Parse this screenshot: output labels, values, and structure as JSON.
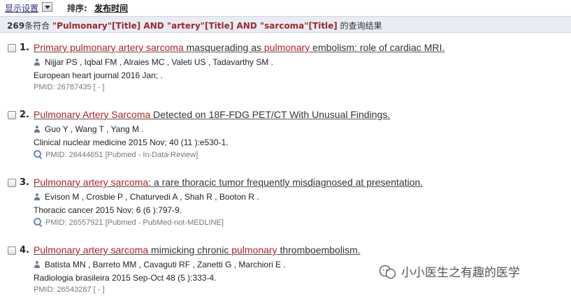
{
  "toolbar": {
    "display_settings": "显示设置",
    "sort_label": "排序:",
    "sort_value": "发布时间"
  },
  "summary": {
    "count": "269",
    "pre": "条符合 ",
    "query": "\"Pulmonary\"[Title] AND \"artery\"[Title] AND \"sarcoma\"[Title]",
    "post": " 的查询结果"
  },
  "results": [
    {
      "num": "1.",
      "title_parts": [
        {
          "t": "Primary pulmonary artery sarcoma",
          "hl": true
        },
        {
          "t": " masquerading as ",
          "hl": false
        },
        {
          "t": "pulmonary",
          "hl": true
        },
        {
          "t": " embolism: role of cardiac MRI.",
          "hl": false
        }
      ],
      "authors": "Nijjar PS , Iqbal FM , Alraies MC , Valeti US , Tadavarthy SM .",
      "journal": "European heart journal 2016 Jan; .",
      "pmid": "PMID: 26787435 [ - ]",
      "has_related_icon": false
    },
    {
      "num": "2.",
      "title_parts": [
        {
          "t": "Pulmonary Artery Sarcoma",
          "hl": true
        },
        {
          "t": " Detected on 18F-FDG PET/CT With Unusual Findings.",
          "hl": false
        }
      ],
      "authors": "Guo Y , Wang T , Yang M .",
      "journal": "Clinical nuclear medicine 2015 Nov; 40 (11 ):e530-1.",
      "pmid": "PMID: 26444651 [Pubmed - In-Data-Review]",
      "has_related_icon": true
    },
    {
      "num": "3.",
      "title_parts": [
        {
          "t": "Pulmonary artery sarcoma",
          "hl": true
        },
        {
          "t": ": a rare thoracic tumor frequently misdiagnosed at presentation.",
          "hl": false
        }
      ],
      "authors": "Evison M , Crosbie P , Chaturvedi A , Shah R , Booton R .",
      "journal": "Thoracic cancer 2015 Nov; 6 (6 ):797-9.",
      "pmid": "PMID: 26557921 [Pubmed - PubMed-not-MEDLINE]",
      "has_related_icon": true
    },
    {
      "num": "4.",
      "title_parts": [
        {
          "t": "Pulmonary artery sarcoma",
          "hl": true
        },
        {
          "t": " mimicking chronic ",
          "hl": false
        },
        {
          "t": "pulmonary",
          "hl": true
        },
        {
          "t": " thromboembolism.",
          "hl": false
        }
      ],
      "authors": "Batista MN , Barreto MM , Cavaguti RF , Zanetti G , Marchiori E .",
      "journal": "Radiologia brasileira 2015 Sep-Oct 48 (5 ):333-4.",
      "pmid": "PMID: 26543287 [ - ]",
      "has_related_icon": false
    }
  ],
  "watermark": "小小医生之有趣的医学",
  "colors": {
    "highlight": "#b32025",
    "summary_bg": "#e9edf3",
    "query": "#a0282e"
  }
}
